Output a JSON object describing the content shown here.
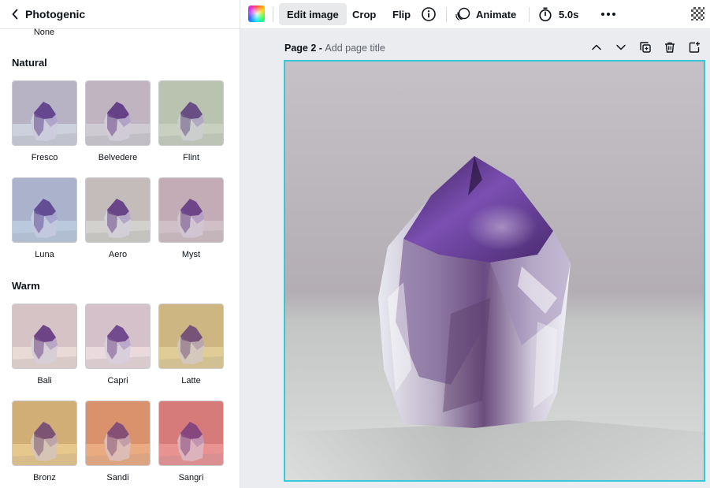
{
  "panel": {
    "title": "Photogenic",
    "none_label": "None",
    "sections": [
      {
        "title": "Natural",
        "filters": [
          {
            "label": "Fresco"
          },
          {
            "label": "Belvedere"
          },
          {
            "label": "Flint"
          },
          {
            "label": "Luna"
          },
          {
            "label": "Aero"
          },
          {
            "label": "Myst"
          }
        ]
      },
      {
        "title": "Warm",
        "filters": [
          {
            "label": "Bali"
          },
          {
            "label": "Capri"
          },
          {
            "label": "Latte"
          },
          {
            "label": "Bronz"
          },
          {
            "label": "Sandi"
          },
          {
            "label": "Sangri"
          }
        ]
      }
    ]
  },
  "toolbar": {
    "edit_image": "Edit image",
    "crop": "Crop",
    "flip": "Flip",
    "animate": "Animate",
    "duration": "5.0s"
  },
  "page": {
    "name": "Page 2 - ",
    "title_placeholder": "Add page title"
  },
  "colors": {
    "selection_border": "#35c8d6",
    "canvas_bg": "#ebecf0"
  },
  "icons": {
    "back": "chevron-left-icon",
    "info": "info-icon",
    "animate": "animate-icon",
    "timer": "timer-icon",
    "more": "more-icon",
    "transparency": "transparency-icon",
    "move_up": "chevron-up-icon",
    "move_down": "chevron-down-icon",
    "duplicate": "duplicate-icon",
    "delete": "trash-icon",
    "add_page": "add-page-icon"
  }
}
